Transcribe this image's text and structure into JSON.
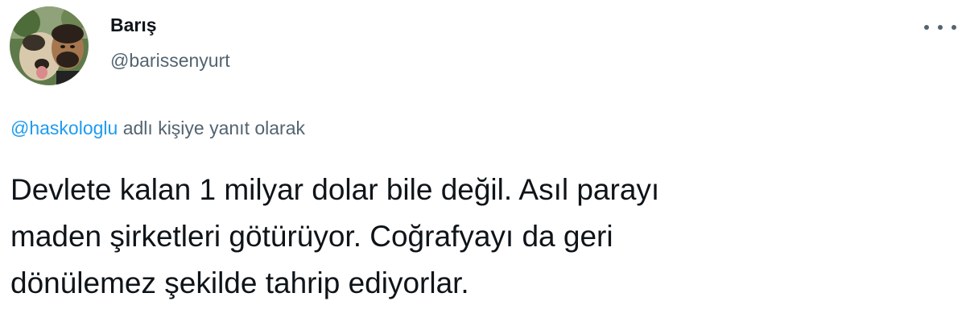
{
  "user": {
    "display_name": "Barış",
    "handle": "@barissenyurt",
    "avatar": "profile-photo-man-with-dog"
  },
  "more_menu": {
    "icon": "more-horizontal-icon"
  },
  "reply_context": {
    "mention": "@haskologlu",
    "suffix": "adlı kişiye yanıt olarak"
  },
  "tweet": {
    "lines": [
      "Devlete kalan 1 milyar dolar bile değil. Asıl parayı",
      "maden şirketleri götürüyor. Coğrafyayı da geri",
      "dönülemez şekilde tahrip ediyorlar."
    ]
  },
  "colors": {
    "text": "#0f1419",
    "secondary": "#536471",
    "link": "#1d9bf0"
  }
}
